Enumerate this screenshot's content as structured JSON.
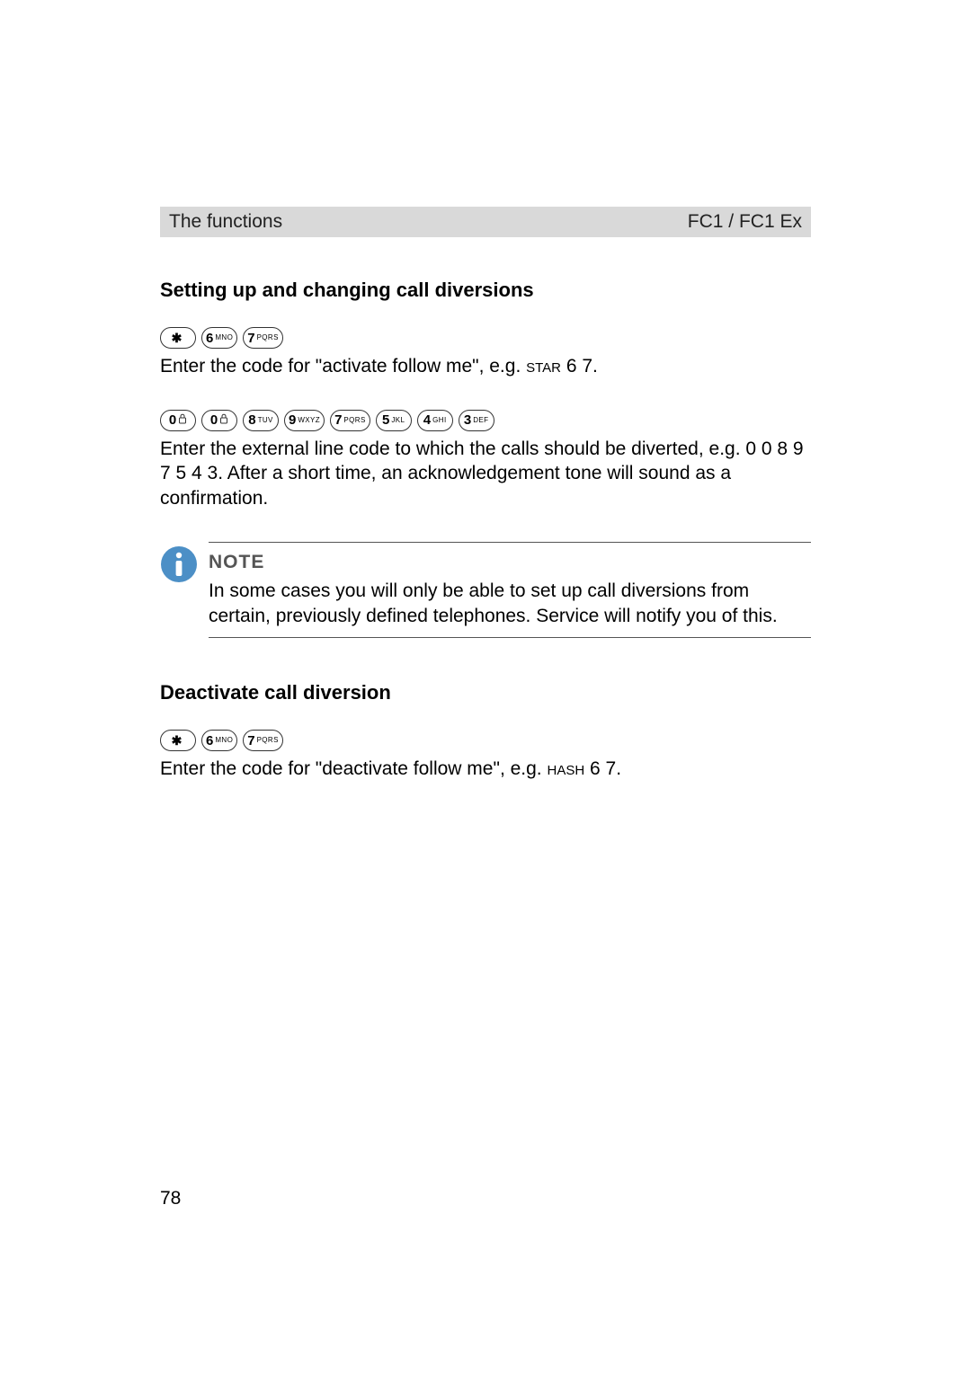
{
  "header": {
    "left": "The functions",
    "right": "FC1 / FC1 Ex"
  },
  "section1": {
    "title": "Setting up and changing call diversions",
    "keys1": {
      "star": "✱",
      "k6": {
        "d": "6",
        "s": "MNO"
      },
      "k7": {
        "d": "7",
        "s": "PQRS"
      }
    },
    "text1_a": "Enter the code for \"activate follow me\", e.g. ",
    "text1_sc": "star",
    "text1_b": " 6 7.",
    "keys2": {
      "k0a": {
        "d": "0"
      },
      "k0b": {
        "d": "0"
      },
      "k8": {
        "d": "8",
        "s": "TUV"
      },
      "k9": {
        "d": "9",
        "s": "WXYZ"
      },
      "k7": {
        "d": "7",
        "s": "PQRS"
      },
      "k5": {
        "d": "5",
        "s": "JKL"
      },
      "k4": {
        "d": "4",
        "s": "GHI"
      },
      "k3": {
        "d": "3",
        "s": "DEF"
      }
    },
    "text2": "Enter the external line code to which the calls should be diverted, e.g. 0 0 8 9 7 5 4 3. After a short time, an acknowledgement tone will sound as a confirmation."
  },
  "note": {
    "label": "NOTE",
    "text": "In some cases you will only be able to set up call diversions from certain, previously defined telephones. Service will notify you of this."
  },
  "section2": {
    "title": "Deactivate call diversion",
    "keys": {
      "star": "✱",
      "k6": {
        "d": "6",
        "s": "MNO"
      },
      "k7": {
        "d": "7",
        "s": "PQRS"
      }
    },
    "text_a": "Enter the code for \"deactivate follow me\", e.g. ",
    "text_sc": "hash",
    "text_b": " 6 7."
  },
  "page_number": "78"
}
